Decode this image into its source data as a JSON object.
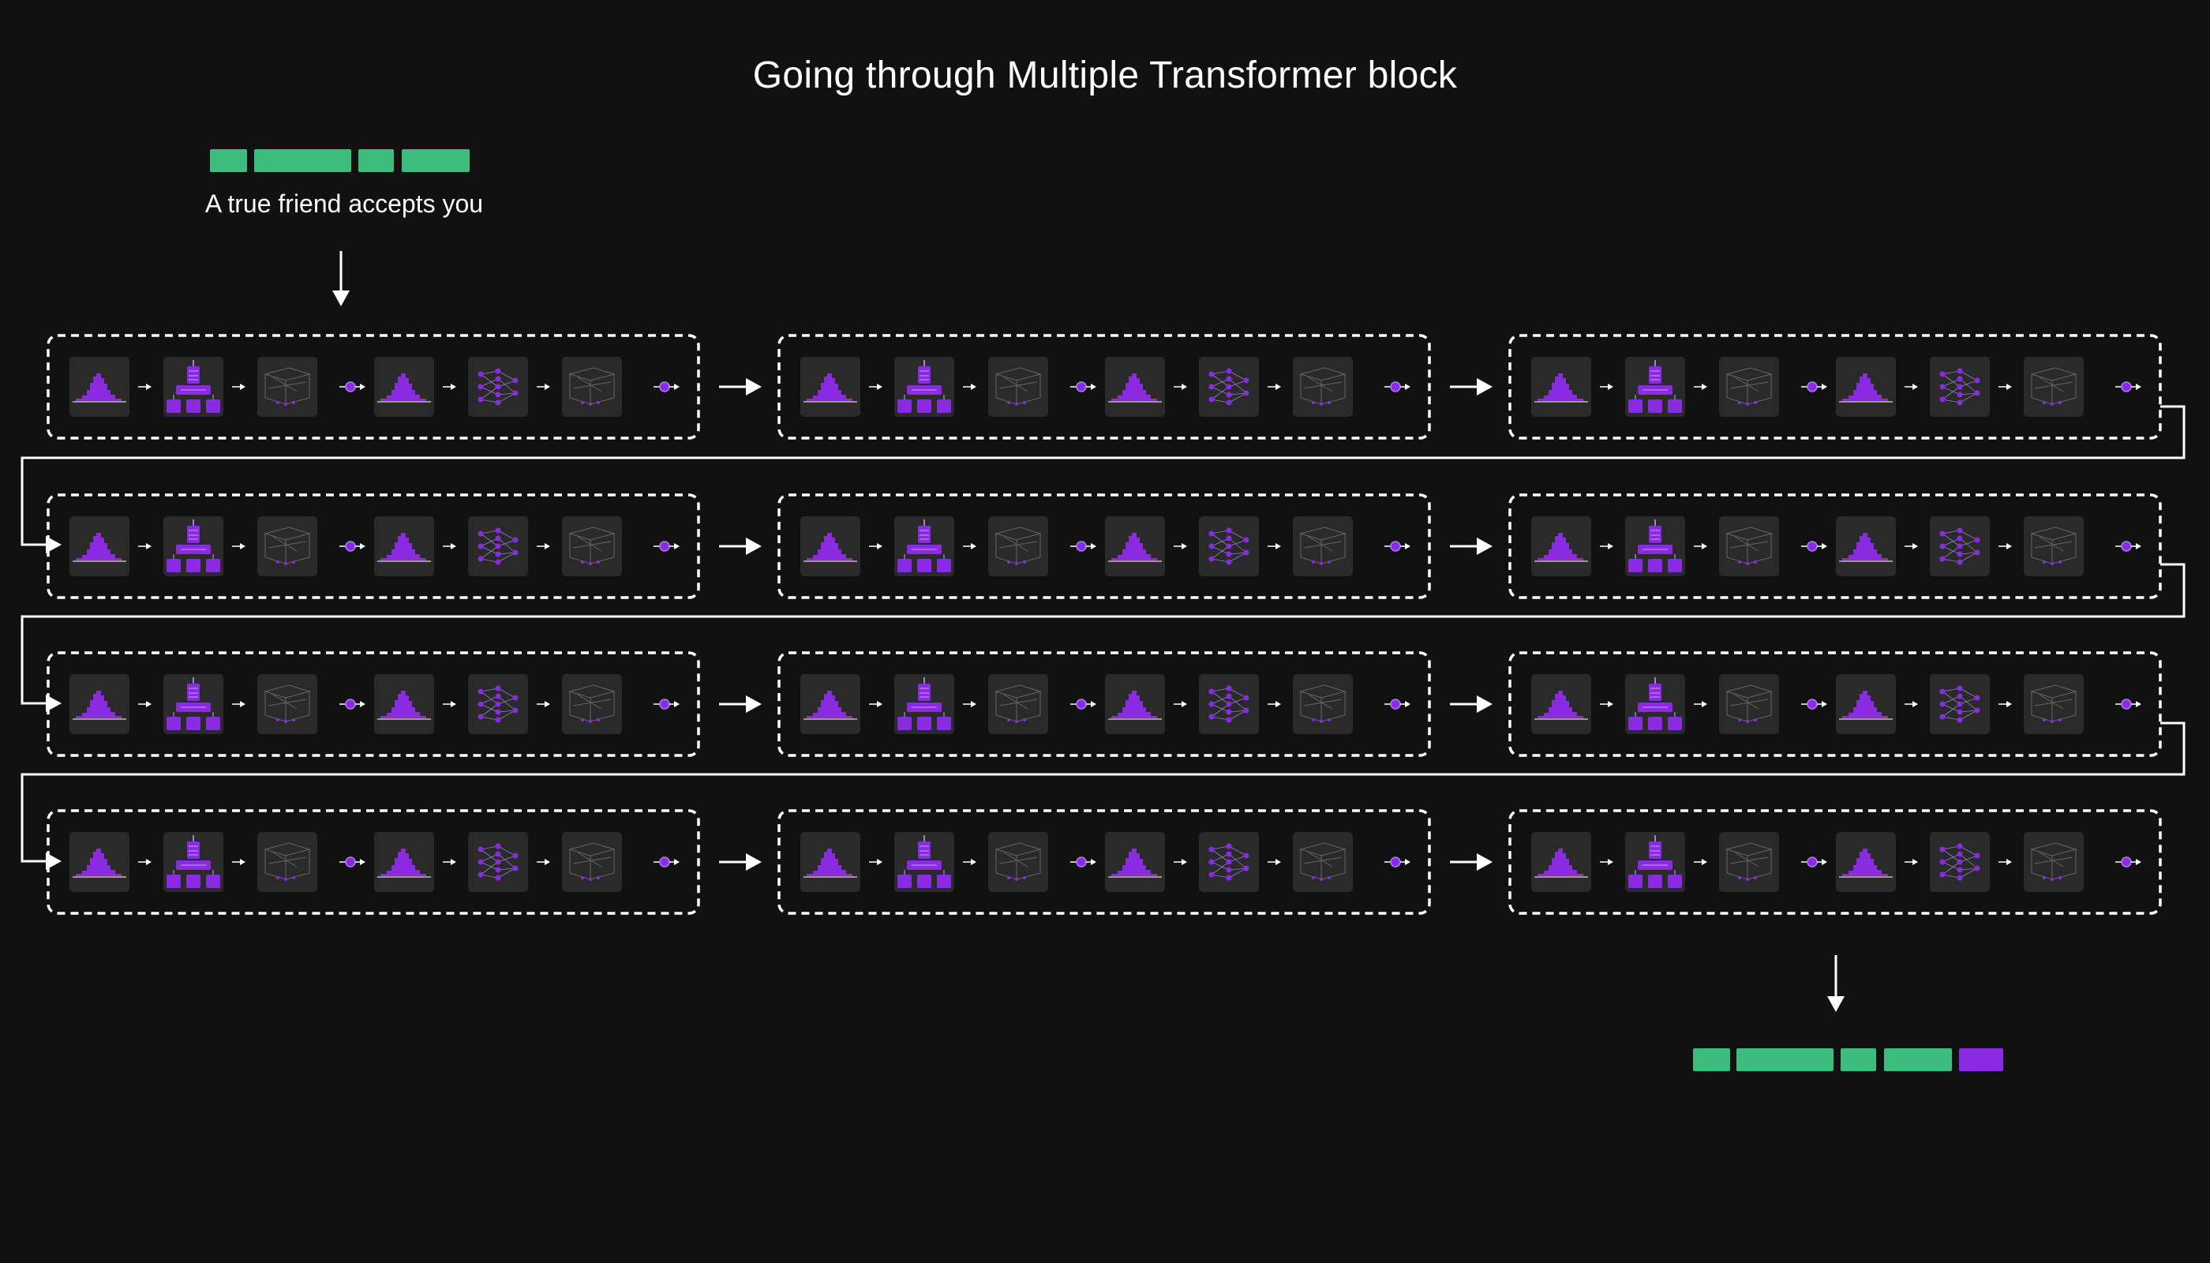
{
  "title": "Going through Multiple Transformer block",
  "input": {
    "text": "A true friend accepts you",
    "token_count": 4
  },
  "output": {
    "token_count": 5,
    "new_token_count": 1
  },
  "blocks": {
    "rows": 4,
    "columns": 3
  },
  "colors": {
    "background": "#111111",
    "token_green": "#3dbd7d",
    "accent_purple": "#8a2be2",
    "tile": "#2a2a2a",
    "stroke": "#ffffff"
  },
  "icons": [
    "layer-norm-icon",
    "attention-icon",
    "projection-icon",
    "residual-add-icon",
    "layer-norm-icon",
    "feed-forward-icon",
    "projection-icon",
    "residual-add-icon"
  ]
}
